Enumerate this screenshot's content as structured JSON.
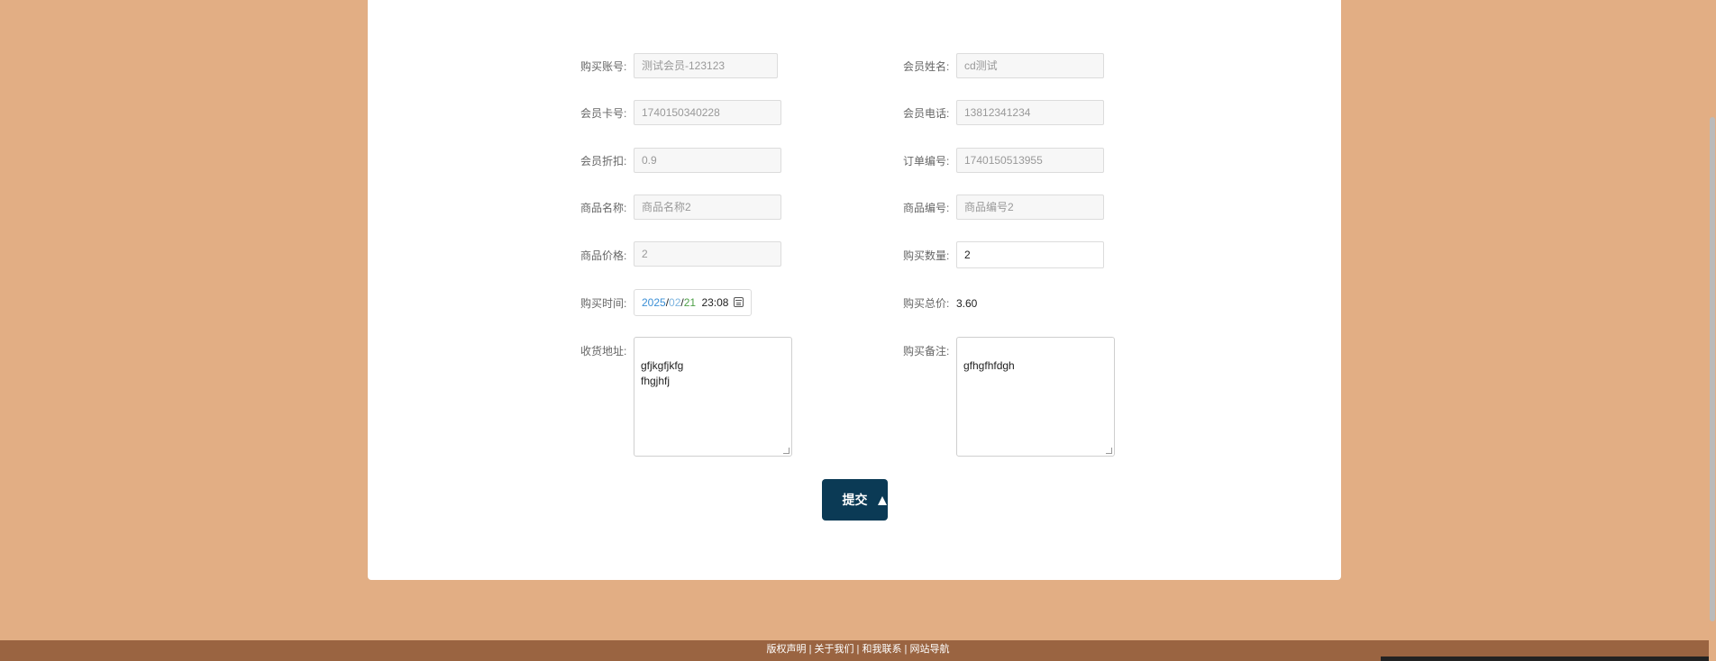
{
  "form": {
    "account": {
      "label": "购买账号:",
      "value": "测试会员-123123"
    },
    "member_name": {
      "label": "会员姓名:",
      "value": "cd测试"
    },
    "card_no": {
      "label": "会员卡号:",
      "value": "1740150340228"
    },
    "phone": {
      "label": "会员电话:",
      "value": "13812341234"
    },
    "discount": {
      "label": "会员折扣:",
      "value": "0.9"
    },
    "order_no": {
      "label": "订单编号:",
      "value": "1740150513955"
    },
    "product_name": {
      "label": "商品名称:",
      "value": "商品名称2"
    },
    "product_no": {
      "label": "商品编号:",
      "value": "商品编号2"
    },
    "price": {
      "label": "商品价格:",
      "value": "2"
    },
    "quantity": {
      "label": "购买数量:",
      "value": "2"
    },
    "time": {
      "label": "购买时间:",
      "year": "2025",
      "month": "02",
      "day": "21",
      "clock": "23:08"
    },
    "total": {
      "label": "购买总价:",
      "value": "3.60"
    },
    "address": {
      "label": "收货地址:",
      "value": "gfjkgfjkfg\nfhgjhfj"
    },
    "note": {
      "label": "购买备注:",
      "value": "gfhgfhfdgh"
    },
    "submit_label": "提交"
  },
  "footer": {
    "text": "版权声明 | 关于我们 | 和我联系 | 网站导航"
  }
}
